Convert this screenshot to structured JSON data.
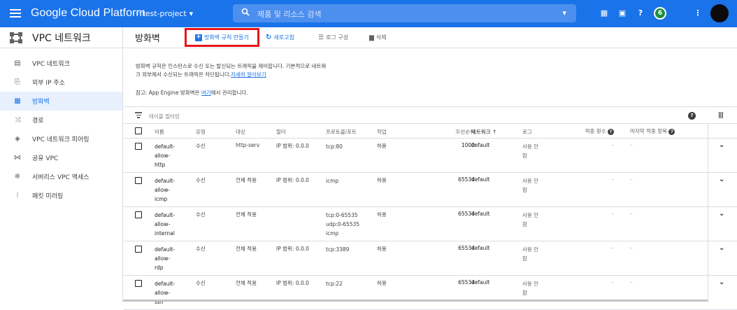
{
  "topbar": {
    "brand": "Google Cloud Platform",
    "project": "test-project",
    "search_placeholder": "제품 및 리소스 검색",
    "notification_count": "6"
  },
  "sidebar": {
    "title": "VPC 네트워크",
    "items": [
      {
        "label": "VPC 네트워크",
        "icon": "network-icon"
      },
      {
        "label": "외부 IP 주소",
        "icon": "ip-address-icon"
      },
      {
        "label": "방화벽",
        "icon": "firewall-icon",
        "active": true
      },
      {
        "label": "경로",
        "icon": "routes-icon"
      },
      {
        "label": "VPC 네트워크 피어링",
        "icon": "peering-icon"
      },
      {
        "label": "공유 VPC",
        "icon": "shared-vpc-icon"
      },
      {
        "label": "서버리스 VPC 액세스",
        "icon": "serverless-icon"
      },
      {
        "label": "패킷 미러링",
        "icon": "packet-mirroring-icon"
      }
    ]
  },
  "toolbar": {
    "page_title": "방화벽",
    "create_label": "방화벽 규칙 만들기",
    "refresh_label": "새로고침",
    "log_label": "로그 구성",
    "delete_label": "삭제"
  },
  "description": {
    "line1": "방화벽 규칙은 인스턴스로 수신 또는 발신되는 트래픽을 제어합니다. 기본적으로 네트워",
    "line2": "크 외부에서 수신되는 트래픽은 차단됩니다.",
    "learn_more": "자세히 알아보기",
    "note_prefix": "참고: App Engine 방화벽은 ",
    "note_link": "여기",
    "note_suffix": "에서 관리합니다."
  },
  "filter": {
    "placeholder": "테이블 필터링"
  },
  "table": {
    "headers": {
      "name": "이름",
      "type": "유형",
      "target": "대상",
      "filter": "필터",
      "protocol": "프로토콜/포트",
      "action": "작업",
      "priority": "우선순위",
      "network": "네트워크 ↑",
      "logs": "로그",
      "hit_count": "적중 횟수",
      "last_hit": "마지막 적중 항목"
    },
    "rows": [
      {
        "name": [
          "default-",
          "allow-",
          "http"
        ],
        "type": "수신",
        "target": "http-serv",
        "filter": "IP 범위: 0.0.0",
        "protocol": [
          "tcp:80"
        ],
        "action": "허용",
        "priority": "1000",
        "network": "default",
        "logs": [
          "사용 안",
          "함"
        ],
        "hits": "–",
        "last": "–"
      },
      {
        "name": [
          "default-",
          "allow-",
          "icmp"
        ],
        "type": "수신",
        "target": "전체 적용",
        "filter": "IP 범위: 0.0.0",
        "protocol": [
          "icmp"
        ],
        "action": "허용",
        "priority": "65534",
        "network": "default",
        "logs": [
          "사용 안",
          "함"
        ],
        "hits": "–",
        "last": "–"
      },
      {
        "name": [
          "default-",
          "allow-",
          "internal"
        ],
        "type": "수신",
        "target": "전체 적용",
        "filter": "",
        "protocol": [
          "tcp:0-65535",
          "udp:0-65535",
          "icmp"
        ],
        "action": "허용",
        "priority": "65534",
        "network": "default",
        "logs": [
          "사용 안",
          "함"
        ],
        "hits": "–",
        "last": "–"
      },
      {
        "name": [
          "default-",
          "allow-",
          "rdp"
        ],
        "type": "수신",
        "target": "전체 적용",
        "filter": "IP 범위: 0.0.0",
        "protocol": [
          "tcp:3389"
        ],
        "action": "허용",
        "priority": "65534",
        "network": "default",
        "logs": [
          "사용 안",
          "함"
        ],
        "hits": "–",
        "last": "–"
      },
      {
        "name": [
          "default-",
          "allow-",
          "ssh"
        ],
        "type": "수신",
        "target": "전체 적용",
        "filter": "IP 범위: 0.0.0",
        "protocol": [
          "tcp:22"
        ],
        "action": "허용",
        "priority": "65534",
        "network": "default",
        "logs": [
          "사용 안",
          "함"
        ],
        "hits": "–",
        "last": "–"
      }
    ]
  }
}
